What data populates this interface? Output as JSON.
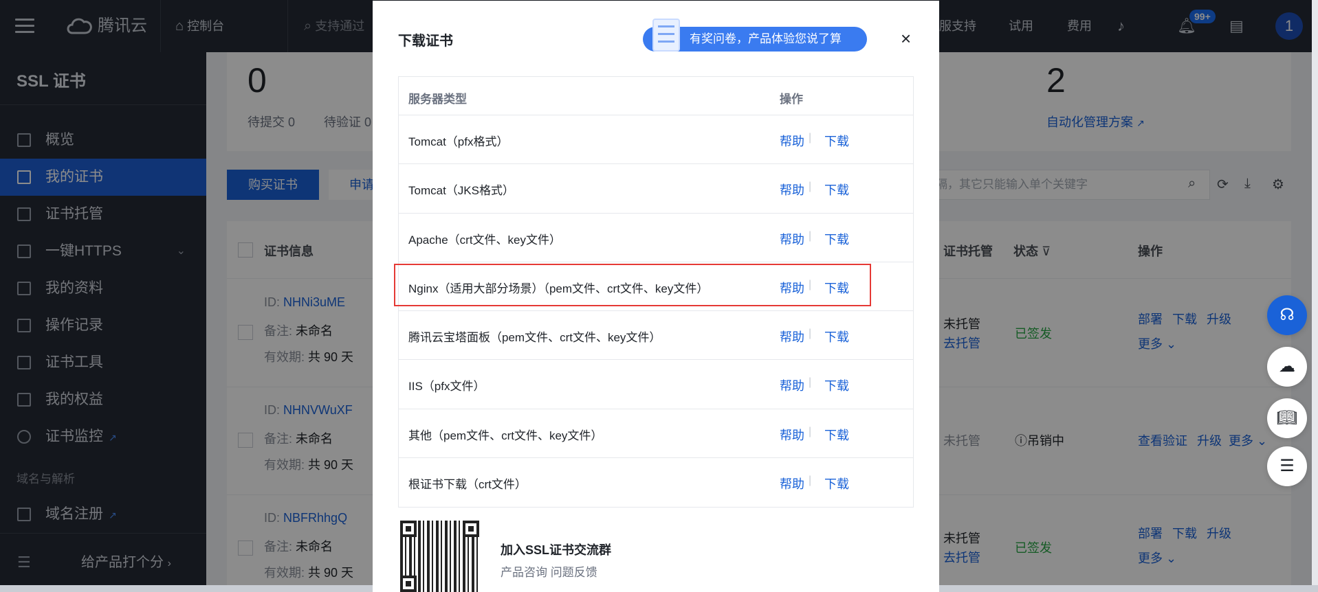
{
  "topbar": {
    "brand": "腾讯云",
    "console": "控制台",
    "search_placeholder": "支持通过",
    "service_support": "服支持",
    "trial": "试用",
    "fees": "费用",
    "notification_count": "99+",
    "avatar_initial": "1"
  },
  "sidebar": {
    "title": "SSL 证书",
    "items": [
      {
        "label": "概览"
      },
      {
        "label": "我的证书"
      },
      {
        "label": "证书托管"
      },
      {
        "label": "一键HTTPS"
      },
      {
        "label": "我的资料"
      },
      {
        "label": "操作记录"
      },
      {
        "label": "证书工具"
      },
      {
        "label": "我的权益"
      },
      {
        "label": "证书监控"
      }
    ],
    "group_label": "域名与解析",
    "domain_item": "域名注册",
    "rate_label": "给产品打个分"
  },
  "summary": {
    "left_count": "0",
    "pending_submit": "待提交 0",
    "pending_verify": "待验证 0",
    "right_count": "2",
    "auto_manage_link": "自动化管理方案"
  },
  "toolbar": {
    "buy_button": "购买证书",
    "apply_button": "申请",
    "search_placeholder": "隔，其它只能输入单个关键字"
  },
  "cert_table": {
    "header_info": "证书信息",
    "header_hosting": "证书托管",
    "header_status": "状态",
    "header_actions": "操作",
    "rows": [
      {
        "id_label": "ID:",
        "id": "NHNi3uME",
        "remark_label": "备注:",
        "remark": "未命名",
        "validity_label": "有效期:",
        "validity": "共 90 天",
        "hosting": "未托管",
        "hosting_link": "去托管",
        "status": "已签发",
        "action1": "部署",
        "action2": "下载",
        "action3": "升级",
        "more": "更多"
      },
      {
        "id_label": "ID:",
        "id": "NHNVWuXF",
        "remark_label": "备注:",
        "remark": "未命名",
        "validity_label": "有效期:",
        "validity": "共 90 天",
        "hosting": "未托管",
        "status": "吊销中",
        "action1": "查看验证",
        "action2": "升级",
        "more": "更多"
      },
      {
        "id_label": "ID:",
        "id": "NBFRhhgQ",
        "remark_label": "备注:",
        "remark": "未命名",
        "validity_label": "有效期:",
        "validity": "共 90 天",
        "hosting": "未托管",
        "hosting_link": "去托管",
        "status": "已签发",
        "action1": "部署",
        "action2": "下载",
        "action3": "升级",
        "more": "更多"
      }
    ]
  },
  "modal": {
    "title": "下载证书",
    "survey": "有奖问卷，产品体验您说了算",
    "close": "×",
    "header_server": "服务器类型",
    "header_action": "操作",
    "help_label": "帮助",
    "download_label": "下载",
    "separator": "|",
    "rows": [
      "Tomcat（pfx格式）",
      "Tomcat（JKS格式）",
      "Apache（crt文件、key文件）",
      "Nginx（适用大部分场景）（pem文件、crt文件、key文件）",
      "腾讯云宝塔面板（pem文件、crt文件、key文件）",
      "IIS（pfx文件）",
      "其他（pem文件、crt文件、key文件）",
      "根证书下载（crt文件）"
    ],
    "join_title": "加入SSL证书交流群",
    "join_sub": "产品咨询 问题反馈"
  }
}
